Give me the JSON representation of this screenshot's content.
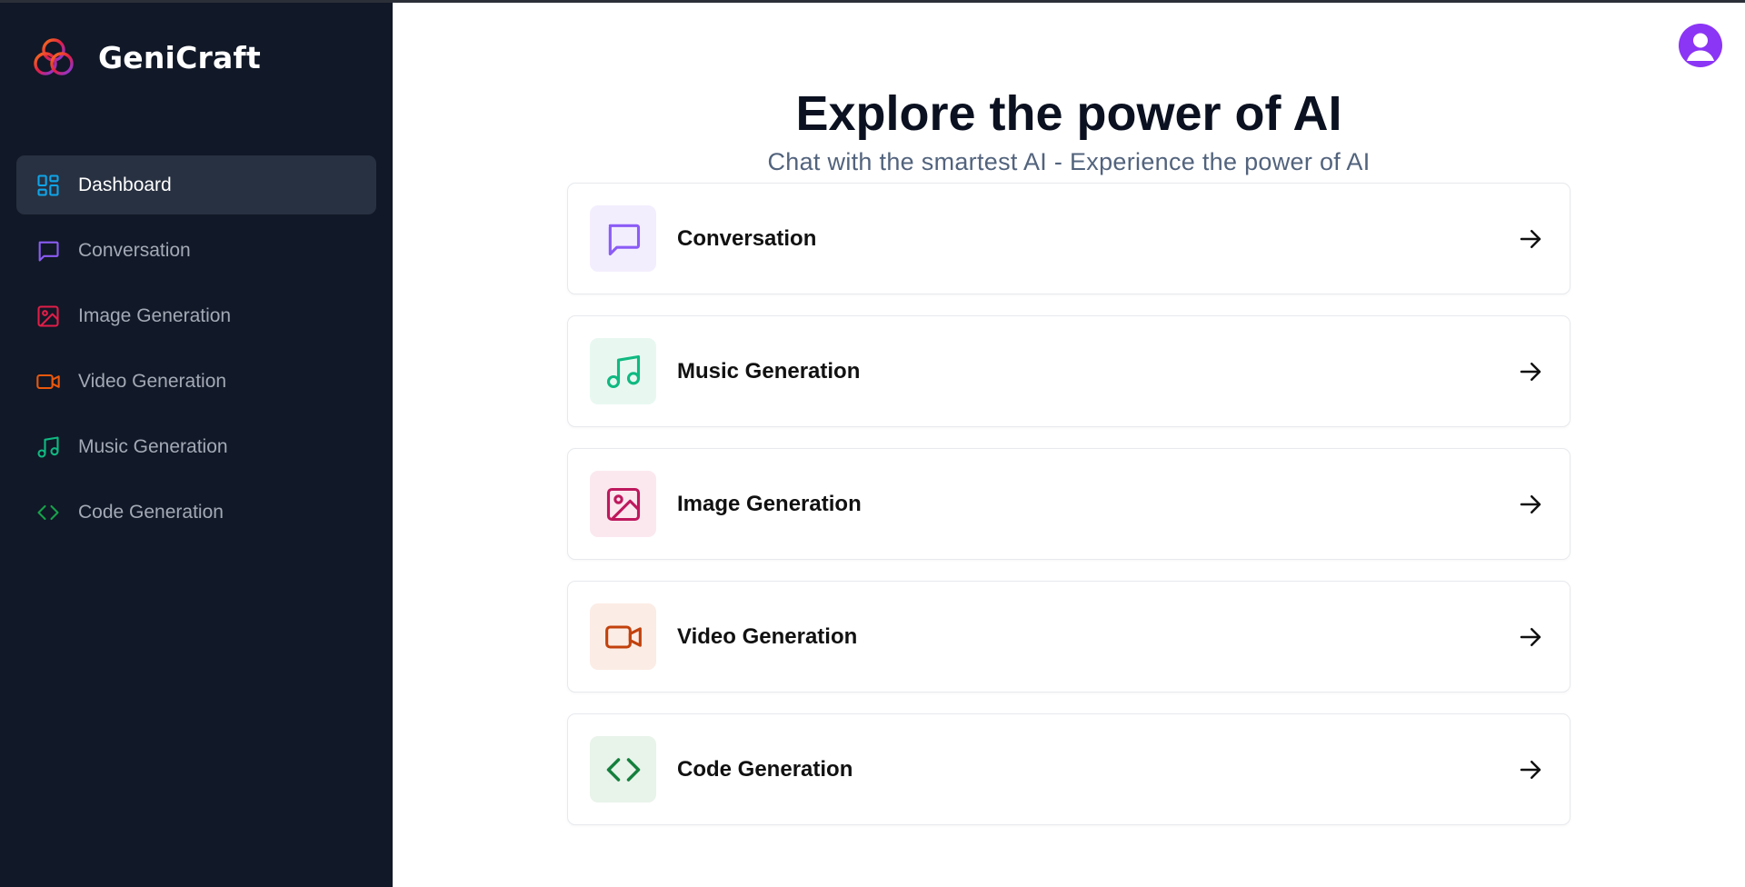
{
  "app": {
    "name": "GeniCraft"
  },
  "sidebar": {
    "items": [
      {
        "label": "Dashboard",
        "icon": "dashboard-icon",
        "color": "#0ea5e9",
        "active": true
      },
      {
        "label": "Conversation",
        "icon": "message-square-icon",
        "color": "#8b5cf6",
        "active": false
      },
      {
        "label": "Image Generation",
        "icon": "image-icon",
        "color": "#e11d48",
        "active": false
      },
      {
        "label": "Video Generation",
        "icon": "video-icon",
        "color": "#ea580c",
        "active": false
      },
      {
        "label": "Music Generation",
        "icon": "music-icon",
        "color": "#10b981",
        "active": false
      },
      {
        "label": "Code Generation",
        "icon": "code-icon",
        "color": "#16a34a",
        "active": false
      }
    ]
  },
  "header": {
    "avatar": "user-avatar-icon",
    "avatar_color": "#8b35f5"
  },
  "main": {
    "title": "Explore the power of AI",
    "subtitle": "Chat with the smartest AI - Experience the power of AI",
    "tools": [
      {
        "label": "Conversation",
        "icon": "message-square-icon",
        "color": "#8b5cf6",
        "bg": "#f3eefe"
      },
      {
        "label": "Music Generation",
        "icon": "music-icon",
        "color": "#10b981",
        "bg": "#e8f8f1"
      },
      {
        "label": "Image Generation",
        "icon": "image-icon",
        "color": "#be185d",
        "bg": "#fbe8ef"
      },
      {
        "label": "Video Generation",
        "icon": "video-icon",
        "color": "#c2410c",
        "bg": "#fbece5"
      },
      {
        "label": "Code Generation",
        "icon": "code-icon",
        "color": "#15803d",
        "bg": "#e8f3ea"
      }
    ]
  }
}
